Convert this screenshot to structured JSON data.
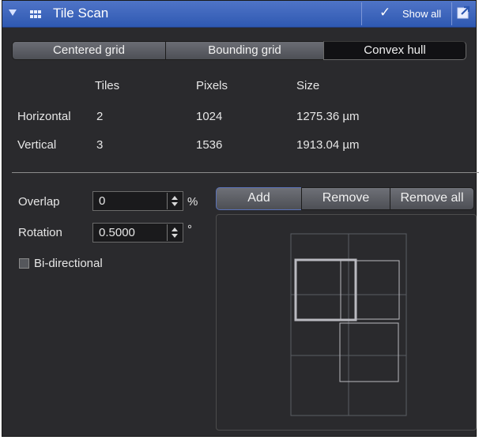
{
  "header": {
    "title": "Tile Scan",
    "show_all_label": "Show all",
    "check_glyph": "✓",
    "icons": [
      "collapse-triangle-icon",
      "tile-scan-icon",
      "checkmark-icon",
      "popout-icon"
    ]
  },
  "mode_tabs": [
    {
      "label": "Centered grid",
      "active": false
    },
    {
      "label": "Bounding grid",
      "active": false
    },
    {
      "label": "Convex hull",
      "active": true
    }
  ],
  "info_table": {
    "columns": [
      "Tiles",
      "Pixels",
      "Size"
    ],
    "rows": [
      {
        "label": "Horizontal",
        "tiles": "2",
        "pixels": "1024",
        "size": "1275.36 µm"
      },
      {
        "label": "Vertical",
        "tiles": "3",
        "pixels": "1536",
        "size": "1913.04 µm"
      }
    ]
  },
  "settings": {
    "overlap": {
      "label": "Overlap",
      "value": "0",
      "unit": "%"
    },
    "rotation": {
      "label": "Rotation",
      "value": "0.5000",
      "unit": "°"
    },
    "bidirectional": {
      "label": "Bi-directional",
      "checked": false
    }
  },
  "position_buttons": {
    "add": "Add",
    "remove": "Remove",
    "remove_all": "Remove all"
  },
  "colors": {
    "header_blue": "#3d63bd",
    "panel_bg": "#2a2a2d",
    "tile_outline": "#b9b9c0",
    "grid_line": "#5a5d64"
  }
}
